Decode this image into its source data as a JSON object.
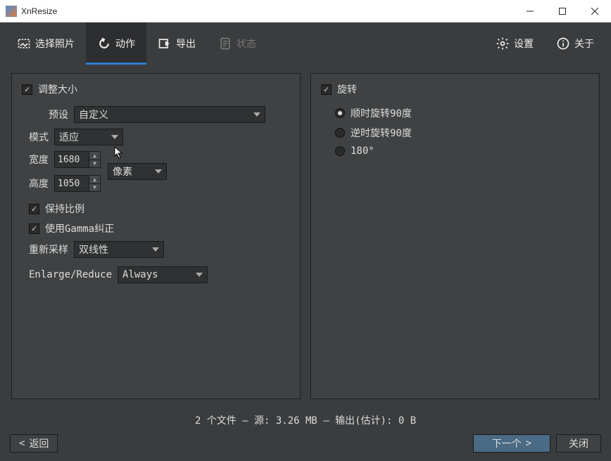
{
  "window": {
    "title": "XnResize"
  },
  "tabs": {
    "select": "选择照片",
    "action": "动作",
    "export": "导出",
    "status": "状态",
    "settings": "设置",
    "about": "关于"
  },
  "resize": {
    "title": "调整大小",
    "preset_label": "预设",
    "preset_value": "自定义",
    "mode_label": "模式",
    "mode_value": "适应",
    "width_label": "宽度",
    "width_value": "1680",
    "height_label": "高度",
    "height_value": "1050",
    "unit_value": "像素",
    "keep_ratio": "保持比例",
    "gamma": "使用Gamma纠正",
    "resample_label": "重新采样",
    "resample_value": "双线性",
    "enlarge_label": "Enlarge/Reduce",
    "enlarge_value": "Always"
  },
  "rotate": {
    "title": "旋转",
    "cw90": "顺时旋转90度",
    "ccw90": "逆时旋转90度",
    "r180": "180°"
  },
  "status_text": "2 个文件 – 源: 3.26 MB – 输出(估计): 0 B",
  "footer": {
    "back": "返回",
    "next": "下一个",
    "close": "关闭"
  }
}
